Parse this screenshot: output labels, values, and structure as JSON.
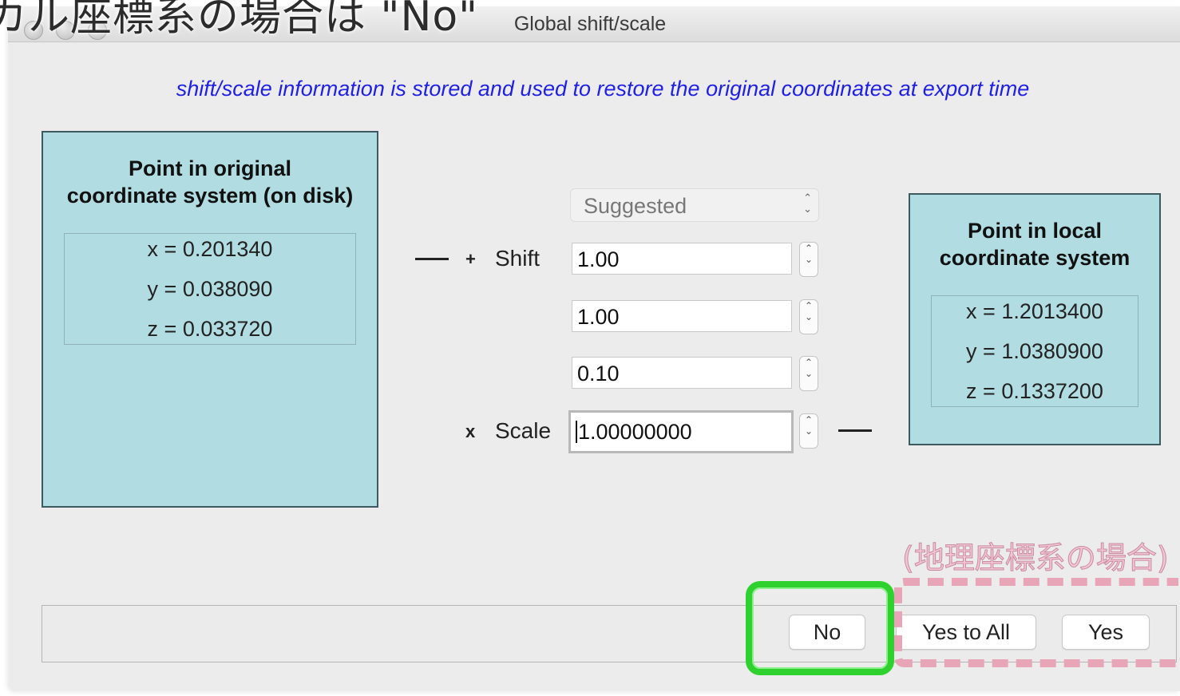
{
  "window": {
    "title": "Global shift/scale",
    "overlay_caption": "カル座標系の場合は \"No\""
  },
  "info_text": "shift/scale information is stored and used to restore the original coordinates at export time",
  "original_panel": {
    "title_line1": "Point in original",
    "title_line2": "coordinate system (on disk)",
    "x": "x = 0.201340",
    "y": "y = 0.038090",
    "z": "z = 0.033720"
  },
  "local_panel": {
    "title_line1": "Point in local",
    "title_line2": "coordinate system",
    "x": "x = 1.2013400",
    "y": "y = 1.0380900",
    "z": "z = 0.1337200"
  },
  "controls": {
    "suggested_select": "Suggested",
    "shift_operator": "+",
    "shift_label": "Shift",
    "shift_x": "1.00",
    "shift_y": "1.00",
    "shift_z": "0.10",
    "scale_operator": "x",
    "scale_label": "Scale",
    "scale_value": "1.00000000"
  },
  "buttons": {
    "no": "No",
    "yes_to_all": "Yes to All",
    "yes": "Yes"
  },
  "annotation": {
    "pink_caption": "(地理座標系の場合)",
    "highlight_color": "#2ed12e",
    "dash_color": "#e9a5b8"
  }
}
